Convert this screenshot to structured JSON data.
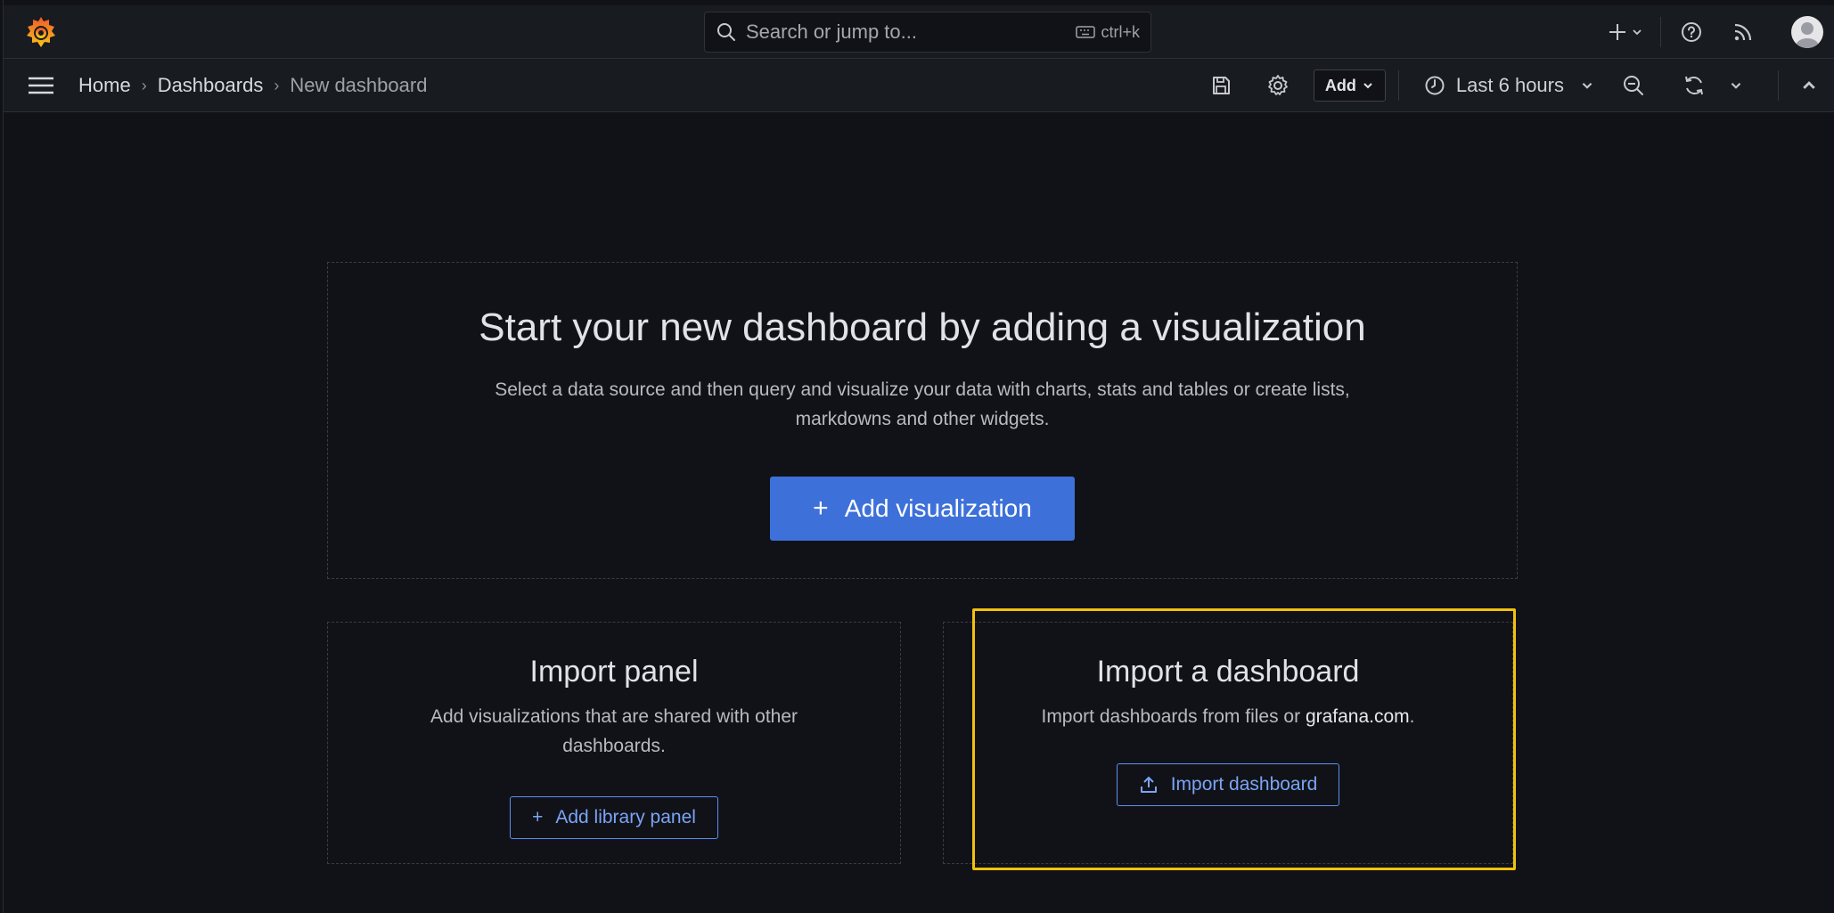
{
  "search": {
    "placeholder": "Search or jump to...",
    "shortcut": "ctrl+k"
  },
  "breadcrumb": {
    "home": "Home",
    "dashboards": "Dashboards",
    "current": "New dashboard"
  },
  "toolbar": {
    "add_label": "Add",
    "time_range": "Last 6 hours"
  },
  "main": {
    "title": "Start your new dashboard by adding a visualization",
    "description": "Select a data source and then query and visualize your data with charts, stats and tables or create lists, markdowns and other widgets.",
    "add_visualization": "Add visualization",
    "import_panel": {
      "title": "Import panel",
      "description": "Add visualizations that are shared with other dashboards.",
      "button": "Add library panel"
    },
    "import_dashboard": {
      "title": "Import a dashboard",
      "description_prefix": "Import dashboards from files or ",
      "description_link": "grafana.com",
      "description_suffix": ".",
      "button": "Import dashboard"
    }
  },
  "colors": {
    "accent": "#3d71d9",
    "highlight": "#f2c10d",
    "link": "#7aa4f6",
    "background": "#111217"
  }
}
